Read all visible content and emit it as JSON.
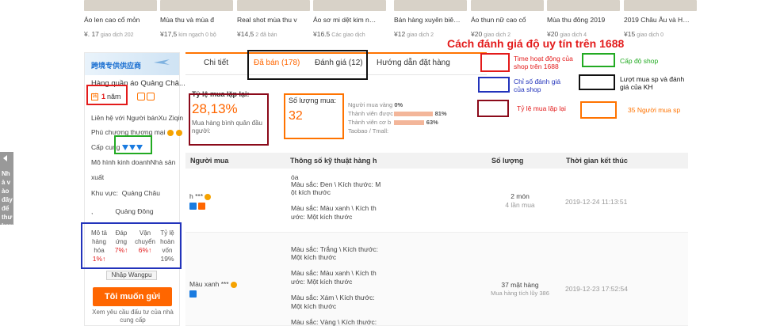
{
  "products": [
    {
      "name": "Áo len cao cổ mỏn",
      "price": "¥. 17",
      "sold": "giao dịch 202"
    },
    {
      "name": "Mùa thu và mùa đ",
      "price": "¥17,5",
      "sold": "kim ngạch 0 bộ"
    },
    {
      "name": "Real shot mùa thu v",
      "price": "¥14,5",
      "sold": "2 đã bán"
    },
    {
      "name": "Áo sơ mi dệt kim n…",
      "price": "¥16.5",
      "sold": "Các giao dịch"
    },
    {
      "name": "Bán hàng xuyên biê…",
      "price": "¥12",
      "sold": "giao dịch 2"
    },
    {
      "name": "Áo thun nữ cao cổ",
      "price": "¥20",
      "sold": "giao dịch 2"
    },
    {
      "name": "Mùa thu đông 2019",
      "price": "¥20",
      "sold": "giao dịch 4"
    },
    {
      "name": "2019 Châu Âu và H…",
      "price": "¥15",
      "sold": "giao dịch 0"
    }
  ],
  "headline": "Cách đánh giá độ uy tín trên 1688",
  "left_edge_text": "Nhà vào đây để thư lượ",
  "sidebar": {
    "banner": "跨境专供供应商",
    "store_name": "Hàng quần áo Quảng Châ...",
    "year_icon": "诚",
    "year_value": "1",
    "year_unit": "năm",
    "line1": "Liên hệ với Người bánXu Ziqin",
    "line2": "Phú chương thương mại",
    "line3": "Cấp cung",
    "line4": "Mô hình kinh doanhNhà sản",
    "line5": "xuất",
    "line6_label": "Khu vực:",
    "line6_value": "Quảng Châu",
    "line7_label": ",",
    "line7_value": "Quảng Đông",
    "metrics": [
      {
        "label_lines": [
          "Mô tả",
          "hàng",
          "hóa"
        ],
        "value": "1%↑",
        "red": true
      },
      {
        "label_lines": [
          "Đáp",
          "ứng"
        ],
        "value": "7%↑",
        "red": true
      },
      {
        "label_lines": [
          "Vận",
          "chuyển"
        ],
        "value": "6%↑",
        "red": true
      },
      {
        "label_lines": [
          "Tỷ lệ",
          "hoàn",
          "vốn"
        ],
        "value": "19%",
        "red": false
      }
    ],
    "import_btn": "Nhập Wangpu",
    "cta": "Tôi muốn gửi",
    "cta_note": "Xem yêu cầu đấu tư của nhà cung cấp"
  },
  "tabs": [
    {
      "label": "Chi tiết",
      "active": false
    },
    {
      "label": "Đã bán (178)",
      "active": true
    },
    {
      "label": "Đánh giá (12)",
      "active": false
    },
    {
      "label": "Hướng dẫn đặt hàng",
      "active": false
    }
  ],
  "stats": {
    "repeat_label": "Tỷ lệ mua lặp lại:",
    "repeat_value": "28,13%",
    "repeat_sub": "Mua hàng bình quân đầu người:",
    "qty_label": "Số lượng mua:",
    "qty_value": "32",
    "bars": [
      {
        "label": "Người mua vàng",
        "pct": "0%",
        "fraction": 0
      },
      {
        "label": "Thành viên được",
        "pct": "81%",
        "fraction": 0.81
      },
      {
        "label": "Thành viên cơ b",
        "pct": "63%",
        "fraction": 0.63
      },
      {
        "label": "Taobao / Tmall:",
        "pct": "",
        "fraction": 0
      }
    ]
  },
  "legend": [
    {
      "text": "Time hoạt động của shop trên 1688",
      "color": "#e31b1b"
    },
    {
      "text": "Cấp độ shop",
      "color": "#22aa22"
    },
    {
      "text": "Chỉ số đánh giá của shop",
      "color": "#2233bb"
    },
    {
      "text": "Lượt mua sp và đánh giá của KH",
      "color": "#111111"
    },
    {
      "text": "Tỷ lệ mua lặp lại",
      "color": "#e31b1b"
    },
    {
      "text": "35 Người mua sp",
      "color": "#ff7300"
    }
  ],
  "table": {
    "headers": [
      "Người mua",
      "Thông số kỹ thuật hàng h",
      "Số lượng",
      "Thời gian kết thúc"
    ],
    "rows": [
      {
        "buyer": "h ***",
        "specs": [
          "óa",
          "Màu sắc: Đen \\ Kích thước: M",
          "ột kích thước",
          "Màu sắc: Màu xanh \\ Kích th",
          "ước: Một kích thước"
        ],
        "qty": "2 món",
        "qty_sub": "4 lần mua",
        "time": "2019-12-24 11:13:51"
      },
      {
        "buyer": "Màu xanh ***",
        "specs": [
          "Màu sắc: Trắng \\ Kích thước:",
          "Một kích thước",
          "Màu sắc: Màu xanh \\ Kích th",
          "ước: Một kích thước",
          "Màu sắc: Xám \\ Kích thước:",
          "Một kích thước",
          "Màu sắc: Vàng \\ Kích thước:"
        ],
        "qty": "37 mặt hàng",
        "qty_sub": "Mua hàng tích lũy 386",
        "time": "2019-12-23 17:52:54"
      }
    ]
  }
}
